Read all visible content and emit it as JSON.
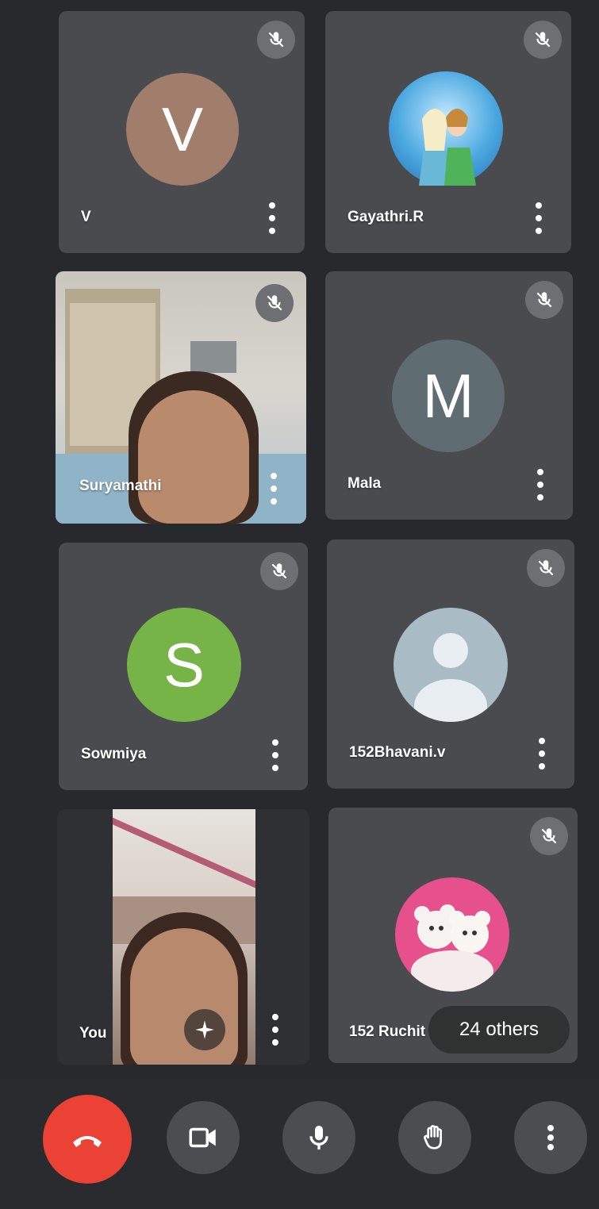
{
  "participants": [
    {
      "name": "V",
      "initial": "V",
      "avatar_color": "#a07e6b"
    },
    {
      "name": "Gayathri.R"
    },
    {
      "name": "Suryamathi"
    },
    {
      "name": "Mala",
      "initial": "M",
      "avatar_color": "#5f6d72"
    },
    {
      "name": "Sowmiya",
      "initial": "S",
      "avatar_color": "#76b447"
    },
    {
      "name": "152Bhavani.v"
    },
    {
      "name": "You"
    },
    {
      "name": "152 Ruchit"
    }
  ],
  "others_label": "24 others",
  "colors": {
    "tile_bg": "#4a4b4e",
    "active_border": "#3b88b8",
    "end_call": "#ea4335",
    "control_bg": "#4c4d50"
  },
  "icons": {
    "mute": "mic-off-icon",
    "more": "more-vert-icon",
    "end": "call-end-icon",
    "camera": "video-camera-icon",
    "mic": "microphone-icon",
    "hand": "raise-hand-icon",
    "effects": "sparkle-effects-icon"
  }
}
